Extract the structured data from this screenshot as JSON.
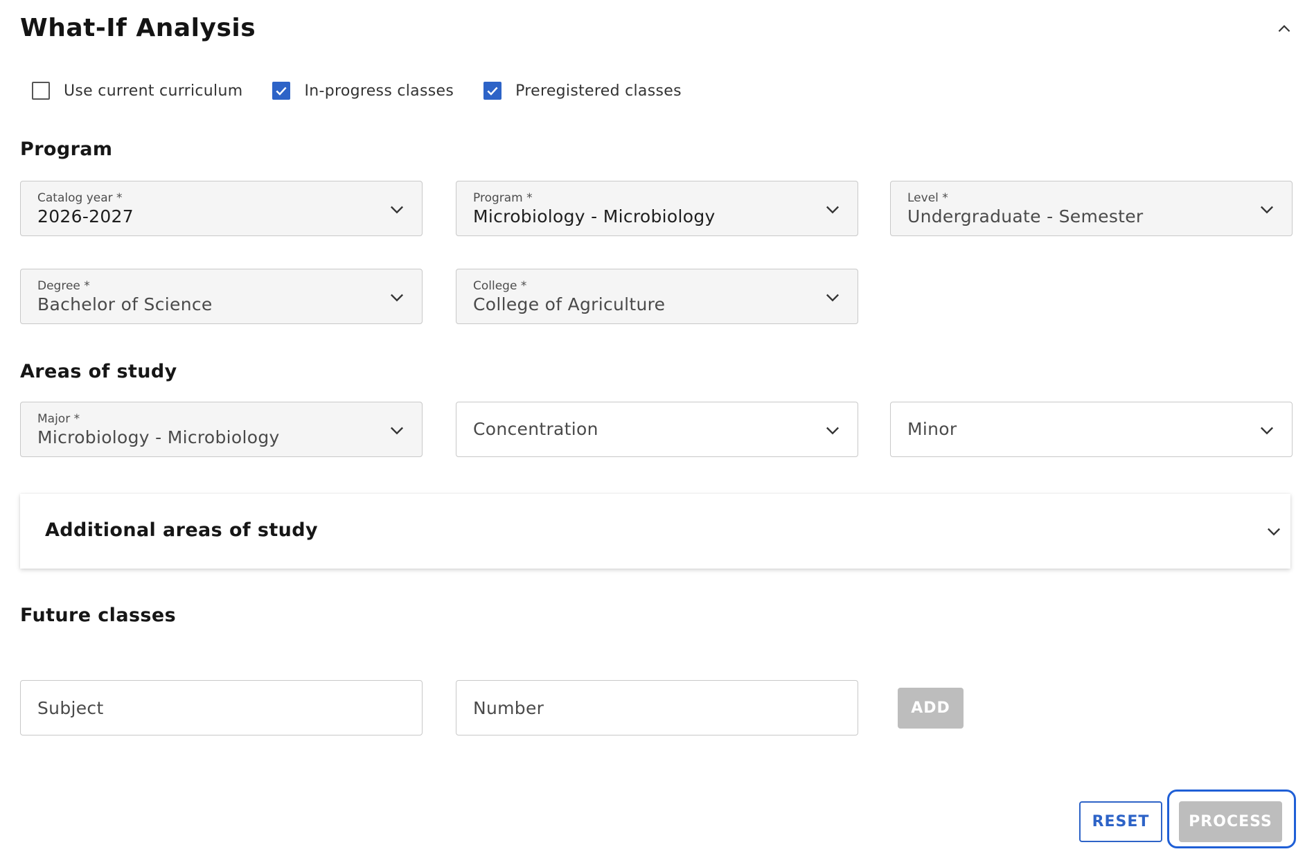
{
  "header": {
    "title": "What-If Analysis"
  },
  "options": [
    {
      "label": "Use current curriculum",
      "checked": false
    },
    {
      "label": "In-progress classes",
      "checked": true
    },
    {
      "label": "Preregistered classes",
      "checked": true
    }
  ],
  "program": {
    "title": "Program",
    "catalog_year": {
      "label": "Catalog year *",
      "value": "2026-2027"
    },
    "program": {
      "label": "Program *",
      "value": "Microbiology - Microbiology"
    },
    "level": {
      "label": "Level *",
      "value": "Undergraduate - Semester"
    },
    "degree": {
      "label": "Degree *",
      "value": "Bachelor of Science"
    },
    "college": {
      "label": "College *",
      "value": "College of Agriculture"
    }
  },
  "areas": {
    "title": "Areas of study",
    "major": {
      "label": "Major *",
      "value": "Microbiology - Microbiology"
    },
    "concentration": {
      "placeholder": "Concentration"
    },
    "minor": {
      "placeholder": "Minor"
    },
    "additional_title": "Additional areas of study"
  },
  "future": {
    "title": "Future classes",
    "subject_placeholder": "Subject",
    "number_placeholder": "Number",
    "add_label": "ADD"
  },
  "actions": {
    "reset_label": "RESET",
    "process_label": "PROCESS"
  },
  "colors": {
    "accent": "#2d63c7",
    "disabled": "#bdbdbd"
  }
}
